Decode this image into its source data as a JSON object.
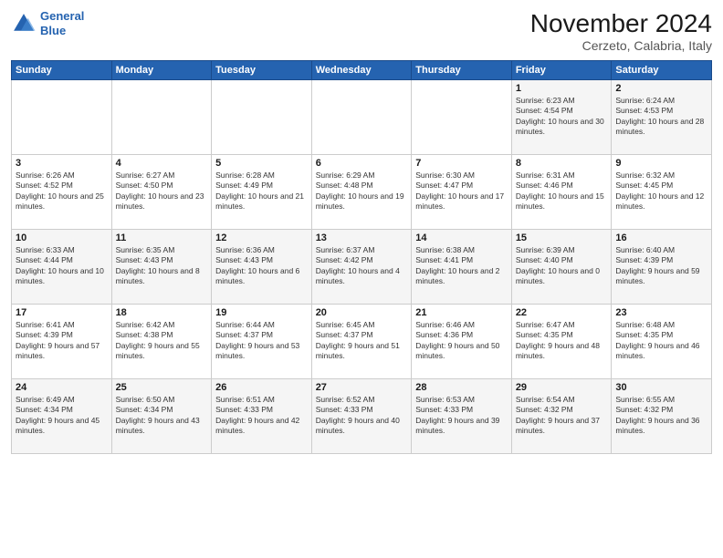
{
  "header": {
    "logo_line1": "General",
    "logo_line2": "Blue",
    "title": "November 2024",
    "location": "Cerzeto, Calabria, Italy"
  },
  "days_of_week": [
    "Sunday",
    "Monday",
    "Tuesday",
    "Wednesday",
    "Thursday",
    "Friday",
    "Saturday"
  ],
  "weeks": [
    {
      "cells": [
        {
          "day": "",
          "info": ""
        },
        {
          "day": "",
          "info": ""
        },
        {
          "day": "",
          "info": ""
        },
        {
          "day": "",
          "info": ""
        },
        {
          "day": "",
          "info": ""
        },
        {
          "day": "1",
          "info": "Sunrise: 6:23 AM\nSunset: 4:54 PM\nDaylight: 10 hours and 30 minutes."
        },
        {
          "day": "2",
          "info": "Sunrise: 6:24 AM\nSunset: 4:53 PM\nDaylight: 10 hours and 28 minutes."
        }
      ]
    },
    {
      "cells": [
        {
          "day": "3",
          "info": "Sunrise: 6:26 AM\nSunset: 4:52 PM\nDaylight: 10 hours and 25 minutes."
        },
        {
          "day": "4",
          "info": "Sunrise: 6:27 AM\nSunset: 4:50 PM\nDaylight: 10 hours and 23 minutes."
        },
        {
          "day": "5",
          "info": "Sunrise: 6:28 AM\nSunset: 4:49 PM\nDaylight: 10 hours and 21 minutes."
        },
        {
          "day": "6",
          "info": "Sunrise: 6:29 AM\nSunset: 4:48 PM\nDaylight: 10 hours and 19 minutes."
        },
        {
          "day": "7",
          "info": "Sunrise: 6:30 AM\nSunset: 4:47 PM\nDaylight: 10 hours and 17 minutes."
        },
        {
          "day": "8",
          "info": "Sunrise: 6:31 AM\nSunset: 4:46 PM\nDaylight: 10 hours and 15 minutes."
        },
        {
          "day": "9",
          "info": "Sunrise: 6:32 AM\nSunset: 4:45 PM\nDaylight: 10 hours and 12 minutes."
        }
      ]
    },
    {
      "cells": [
        {
          "day": "10",
          "info": "Sunrise: 6:33 AM\nSunset: 4:44 PM\nDaylight: 10 hours and 10 minutes."
        },
        {
          "day": "11",
          "info": "Sunrise: 6:35 AM\nSunset: 4:43 PM\nDaylight: 10 hours and 8 minutes."
        },
        {
          "day": "12",
          "info": "Sunrise: 6:36 AM\nSunset: 4:43 PM\nDaylight: 10 hours and 6 minutes."
        },
        {
          "day": "13",
          "info": "Sunrise: 6:37 AM\nSunset: 4:42 PM\nDaylight: 10 hours and 4 minutes."
        },
        {
          "day": "14",
          "info": "Sunrise: 6:38 AM\nSunset: 4:41 PM\nDaylight: 10 hours and 2 minutes."
        },
        {
          "day": "15",
          "info": "Sunrise: 6:39 AM\nSunset: 4:40 PM\nDaylight: 10 hours and 0 minutes."
        },
        {
          "day": "16",
          "info": "Sunrise: 6:40 AM\nSunset: 4:39 PM\nDaylight: 9 hours and 59 minutes."
        }
      ]
    },
    {
      "cells": [
        {
          "day": "17",
          "info": "Sunrise: 6:41 AM\nSunset: 4:39 PM\nDaylight: 9 hours and 57 minutes."
        },
        {
          "day": "18",
          "info": "Sunrise: 6:42 AM\nSunset: 4:38 PM\nDaylight: 9 hours and 55 minutes."
        },
        {
          "day": "19",
          "info": "Sunrise: 6:44 AM\nSunset: 4:37 PM\nDaylight: 9 hours and 53 minutes."
        },
        {
          "day": "20",
          "info": "Sunrise: 6:45 AM\nSunset: 4:37 PM\nDaylight: 9 hours and 51 minutes."
        },
        {
          "day": "21",
          "info": "Sunrise: 6:46 AM\nSunset: 4:36 PM\nDaylight: 9 hours and 50 minutes."
        },
        {
          "day": "22",
          "info": "Sunrise: 6:47 AM\nSunset: 4:35 PM\nDaylight: 9 hours and 48 minutes."
        },
        {
          "day": "23",
          "info": "Sunrise: 6:48 AM\nSunset: 4:35 PM\nDaylight: 9 hours and 46 minutes."
        }
      ]
    },
    {
      "cells": [
        {
          "day": "24",
          "info": "Sunrise: 6:49 AM\nSunset: 4:34 PM\nDaylight: 9 hours and 45 minutes."
        },
        {
          "day": "25",
          "info": "Sunrise: 6:50 AM\nSunset: 4:34 PM\nDaylight: 9 hours and 43 minutes."
        },
        {
          "day": "26",
          "info": "Sunrise: 6:51 AM\nSunset: 4:33 PM\nDaylight: 9 hours and 42 minutes."
        },
        {
          "day": "27",
          "info": "Sunrise: 6:52 AM\nSunset: 4:33 PM\nDaylight: 9 hours and 40 minutes."
        },
        {
          "day": "28",
          "info": "Sunrise: 6:53 AM\nSunset: 4:33 PM\nDaylight: 9 hours and 39 minutes."
        },
        {
          "day": "29",
          "info": "Sunrise: 6:54 AM\nSunset: 4:32 PM\nDaylight: 9 hours and 37 minutes."
        },
        {
          "day": "30",
          "info": "Sunrise: 6:55 AM\nSunset: 4:32 PM\nDaylight: 9 hours and 36 minutes."
        }
      ]
    }
  ]
}
